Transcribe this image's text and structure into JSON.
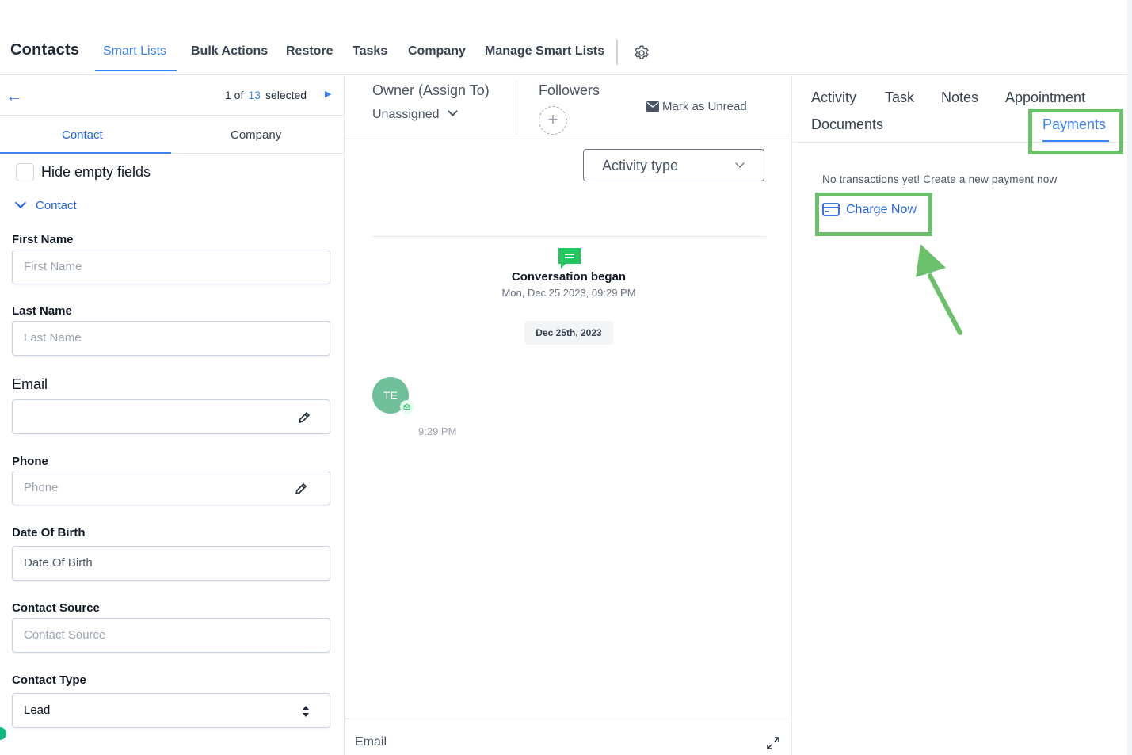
{
  "topnav": {
    "brand": "Contacts",
    "tabs": [
      "Smart Lists",
      "Bulk Actions",
      "Restore",
      "Tasks",
      "Company",
      "Manage Smart Lists"
    ],
    "settings_icon": "gear-icon"
  },
  "left": {
    "pager": {
      "prefix": "1 of",
      "total": "13",
      "suffix": "selected"
    },
    "tabs": [
      "Contact",
      "Company"
    ],
    "hide_empty_label": "Hide empty fields",
    "section_title": "Contact",
    "fields": {
      "first_name": {
        "label": "First Name",
        "placeholder": "First Name"
      },
      "last_name": {
        "label": "Last Name",
        "placeholder": "Last Name"
      },
      "email": {
        "label": "Email",
        "value": ""
      },
      "phone": {
        "label": "Phone",
        "placeholder": "Phone"
      },
      "dob": {
        "label": "Date Of Birth",
        "value": "Date Of Birth"
      },
      "source": {
        "label": "Contact Source",
        "placeholder": "Contact Source"
      },
      "type": {
        "label": "Contact Type",
        "value": "Lead"
      }
    }
  },
  "middle": {
    "owner_label": "Owner (Assign To)",
    "owner_value": "Unassigned",
    "followers_label": "Followers",
    "add_follower": "+",
    "mark_unread": "Mark as Unread",
    "activity_type": "Activity type",
    "conversation_title": "Conversation began",
    "conversation_time": "Mon, Dec 25 2023, 09:29 PM",
    "date_chip": "Dec 25th, 2023",
    "avatar_initials": "TE",
    "message_time": "9:29 PM",
    "composer_label": "Email"
  },
  "right": {
    "tabs": [
      "Activity",
      "Task",
      "Notes",
      "Appointment",
      "Documents",
      "Payments"
    ],
    "empty_message": "No transactions yet! Create a new payment now",
    "charge_now": "Charge Now"
  },
  "colors": {
    "accent": "#3b82f6",
    "highlight": "#6cc06c",
    "avatar": "#6fbf9a",
    "chat_icon": "#22c55e"
  }
}
